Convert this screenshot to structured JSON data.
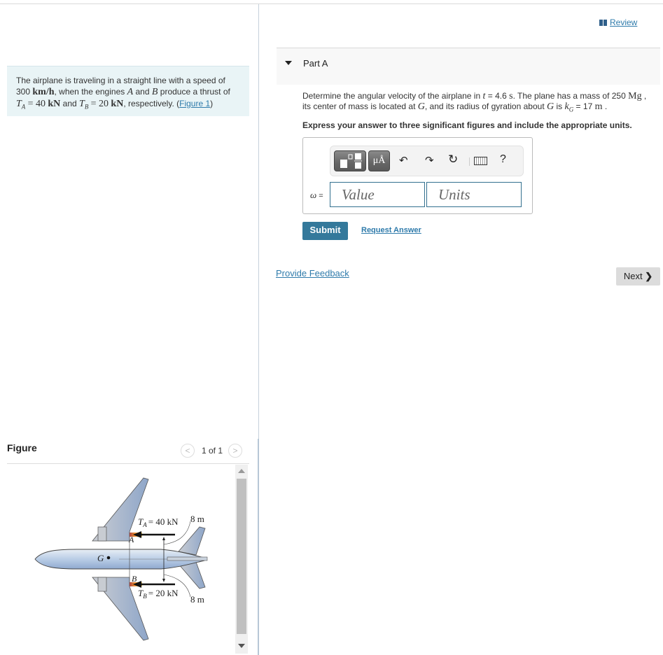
{
  "header": {
    "review_label": "Review"
  },
  "problem": {
    "line1": "The airplane is traveling in a straight line with a speed of",
    "speed_value": "300",
    "speed_unit": "km/h",
    "line2_mid": ", when the engines",
    "engine_a": "A",
    "and": "and",
    "engine_b": "B",
    "line2_end": "produce a thrust of",
    "ta_sym": "T",
    "ta_sub": "A",
    "ta_eq": "= 40",
    "ta_unit": "kN",
    "tb_sym": "T",
    "tb_sub": "B",
    "tb_eq": "= 20",
    "tb_unit": "kN",
    "line3_end": ", respectively. (",
    "figure_link": "Figure 1",
    "close_paren": ")"
  },
  "figure": {
    "title": "Figure",
    "pager": "1 of 1",
    "labels": {
      "ta": "T",
      "ta_sub": "A",
      "ta_val": "= 40 kN",
      "tb": "T",
      "tb_sub": "B",
      "tb_val": "= 20 kN",
      "dist_top": "8 m",
      "dist_bottom": "8 m",
      "point_a": "A",
      "point_b": "B",
      "point_g": "G"
    }
  },
  "part": {
    "title": "Part A",
    "question_1": "Determine the angular velocity of the airplane in",
    "t_sym": "t",
    "t_val": "= 4.6",
    "t_unit": "s",
    "question_2": ". The plane has a mass of 250",
    "mass_unit": "Mg",
    "question_3": ",",
    "question_4": "its center of mass is located at",
    "g_sym": "G",
    "question_5": ", and its radius of gyration about",
    "g_sym2": "G",
    "question_6": "is",
    "k_sym": "k",
    "k_sub": "G",
    "k_val": "= 17",
    "k_unit": "m",
    "question_7": ".",
    "instruction": "Express your answer to three significant figures and include the appropriate units.",
    "answer_label": "ω",
    "answer_eq": " =",
    "value_placeholder": "Value",
    "units_placeholder": "Units",
    "toolbar": {
      "templates": "templates-icon",
      "units_btn": "μÅ",
      "undo": "↶",
      "redo": "↷",
      "reset": "↻",
      "keyboard": "keyboard-icon",
      "help": "?"
    },
    "submit_label": "Submit",
    "request_answer_label": "Request Answer"
  },
  "footer": {
    "feedback_label": "Provide Feedback",
    "next_label": "Next",
    "next_chevron": "❯"
  }
}
